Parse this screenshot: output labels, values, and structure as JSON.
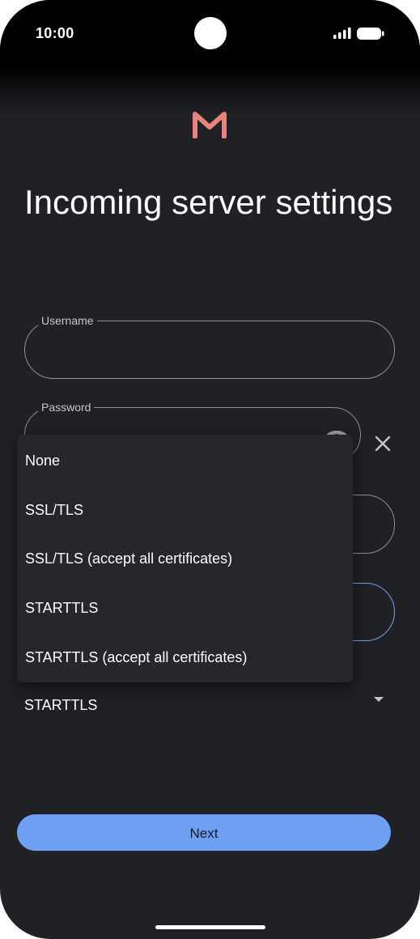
{
  "status_bar": {
    "time": "10:00",
    "icons": [
      "signal-icon",
      "battery-icon"
    ]
  },
  "app": {
    "logo_icon": "m-logo-icon",
    "logo_color": "#e8847b",
    "accent_color": "#6da0f2"
  },
  "page": {
    "title": "Incoming server settings"
  },
  "form": {
    "username": {
      "label": "Username",
      "value": ""
    },
    "password": {
      "label": "Password",
      "value": "",
      "visibility_icon": "eye-icon",
      "clear_icon": "close-icon"
    },
    "security": {
      "value": "STARTTLS",
      "dropdown_icon": "dropdown-arrow-icon"
    }
  },
  "security_menu": {
    "options": [
      {
        "label": "None"
      },
      {
        "label": "SSL/TLS"
      },
      {
        "label": "SSL/TLS (accept all certificates)"
      },
      {
        "label": "STARTTLS"
      },
      {
        "label": "STARTTLS (accept all certificates)"
      }
    ]
  },
  "actions": {
    "next_label": "Next"
  }
}
